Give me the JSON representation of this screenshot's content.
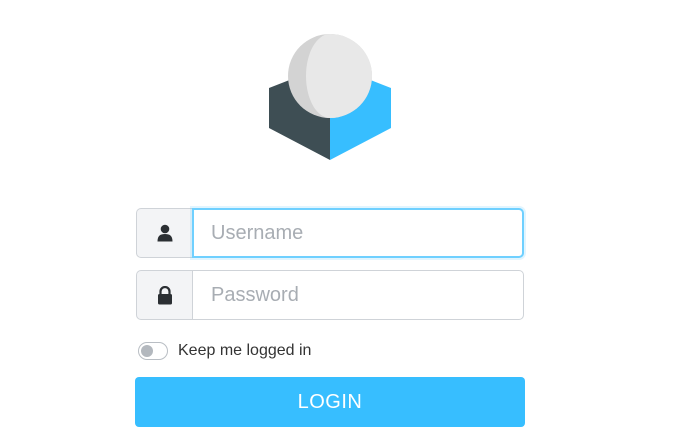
{
  "logo": {
    "icon": "roundcube-logo-icon",
    "colors": {
      "sphere_light": "#e7e7e7",
      "sphere_shade": "#d2d2d2",
      "box_dark": "#3e4e54",
      "box_blue": "#37beff"
    }
  },
  "login_form": {
    "username": {
      "icon": "user-icon",
      "placeholder": "Username",
      "value": "",
      "focused": true
    },
    "password": {
      "icon": "lock-icon",
      "placeholder": "Password",
      "value": ""
    },
    "remember": {
      "label": "Keep me logged in",
      "checked": false
    },
    "submit_label": "LOGIN"
  },
  "colors": {
    "accent": "#37beff",
    "focus_border": "#6fd0ff",
    "addon_bg": "#f3f4f6",
    "border": "#cfd3d8",
    "icon": "#2b2f33"
  }
}
